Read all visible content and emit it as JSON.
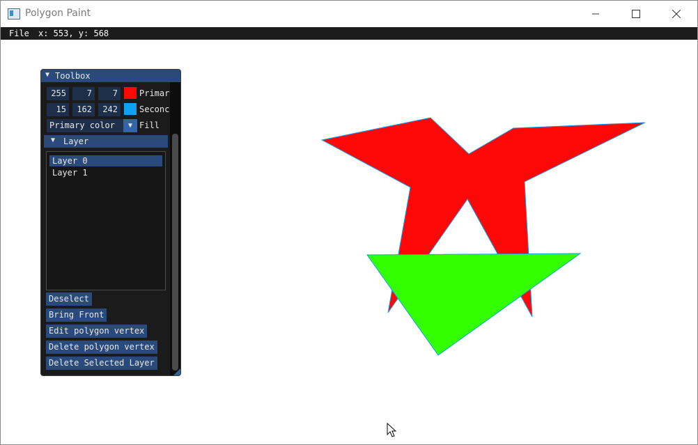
{
  "window": {
    "title": "Polygon Paint"
  },
  "menubar": {
    "file": "File",
    "coords": "x: 553, y: 568"
  },
  "toolbox": {
    "title": "Toolbox",
    "primary": {
      "r": "255",
      "g": "7",
      "b": "7",
      "label": "Primar",
      "color": "#ff0707"
    },
    "secondary": {
      "r": "15",
      "g": "162",
      "b": "242",
      "label": "Seconc",
      "color": "#0fa2f2"
    },
    "fill_source": "Primary color",
    "fill_label": "Fill",
    "layer_section": "Layer",
    "layers": [
      "Layer 0",
      "Layer 1"
    ],
    "buttons": {
      "deselect": "Deselect",
      "bring_front": "Bring Front",
      "edit_vertex": "Edit polygon vertex",
      "delete_vertex": "Delete polygon vertex",
      "delete_layer": "Delete Selected Layer"
    }
  },
  "canvas": {
    "polygon_colors": [
      "#ff0707",
      "#33ff00"
    ],
    "outline_color": "#0fa2f2"
  }
}
